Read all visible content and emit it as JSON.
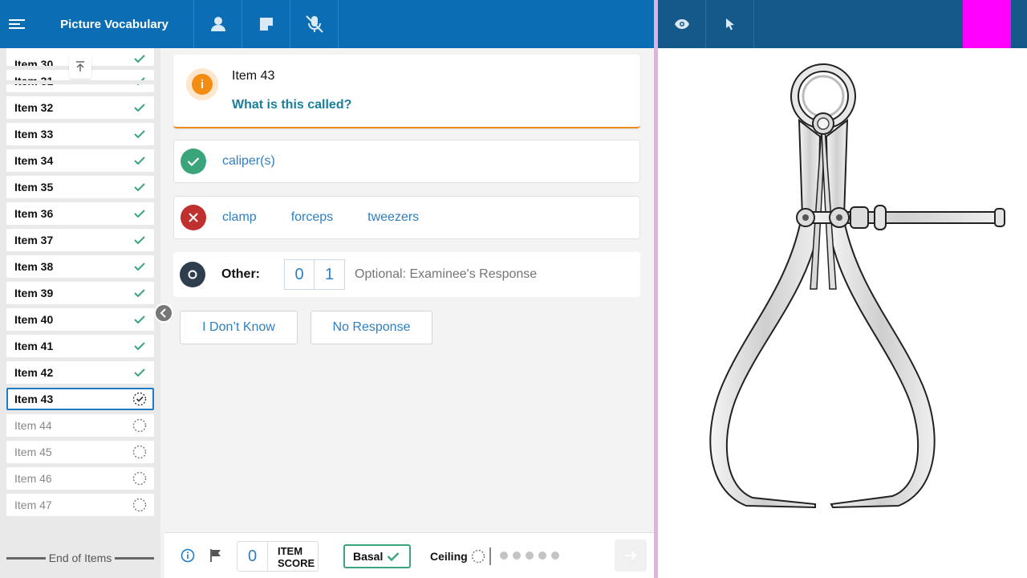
{
  "app": {
    "title": "Picture Vocabulary"
  },
  "sidebar": {
    "partial_item": "Item 30",
    "items": [
      {
        "label": "Item 31",
        "status": "done"
      },
      {
        "label": "Item 32",
        "status": "done"
      },
      {
        "label": "Item 33",
        "status": "done"
      },
      {
        "label": "Item 34",
        "status": "done"
      },
      {
        "label": "Item 35",
        "status": "done"
      },
      {
        "label": "Item 36",
        "status": "done"
      },
      {
        "label": "Item 37",
        "status": "done"
      },
      {
        "label": "Item 38",
        "status": "done"
      },
      {
        "label": "Item 39",
        "status": "done"
      },
      {
        "label": "Item 40",
        "status": "done"
      },
      {
        "label": "Item 41",
        "status": "done"
      },
      {
        "label": "Item 42",
        "status": "done"
      },
      {
        "label": "Item 43",
        "status": "current"
      },
      {
        "label": "Item 44",
        "status": "pending"
      },
      {
        "label": "Item 45",
        "status": "pending"
      },
      {
        "label": "Item 46",
        "status": "pending"
      },
      {
        "label": "Item 47",
        "status": "pending"
      }
    ],
    "end_label": "End of Items"
  },
  "question": {
    "item_label": "Item 43",
    "prompt": "What is this called?"
  },
  "answers": {
    "correct": [
      "caliper(s)"
    ],
    "incorrect": [
      "clamp",
      "forceps",
      "tweezers"
    ],
    "other_label": "Other:",
    "other_scores": [
      "0",
      "1"
    ],
    "other_placeholder": "Optional: Examinee's Response"
  },
  "buttons": {
    "dont_know": "I Don’t Know",
    "no_response": "No Response"
  },
  "footer": {
    "item_score_value": "0",
    "item_score_line1": "ITEM",
    "item_score_line2": "SCORE",
    "basal_label": "Basal",
    "ceiling_label": "Ceiling"
  },
  "colors": {
    "topbar": "#0b6eb4",
    "right_topbar": "#14598a",
    "accent_magenta": "#ff00ff",
    "correct_green": "#3aa57a",
    "incorrect_red": "#c0302e",
    "prompt_teal": "#1b7e9a"
  }
}
